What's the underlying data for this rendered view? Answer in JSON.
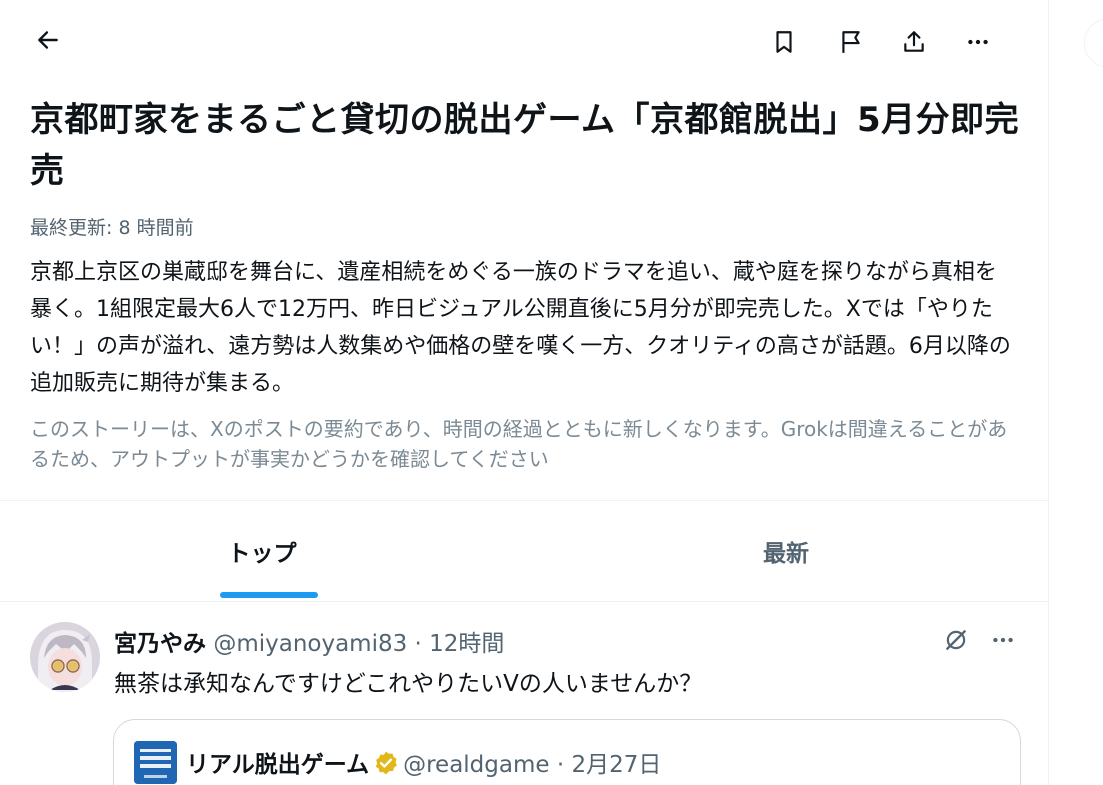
{
  "story": {
    "title": "京都町家をまるごと貸切の脱出ゲーム「京都館脱出」5月分即完売",
    "updated": "最終更新: 8 時間前",
    "summary": "京都上京区の巣蔵邸を舞台に、遺産相続をめぐる一族のドラマを追い、蔵や庭を探りながら真相を暴く。1組限定最大6人で12万円、昨日ビジュアル公開直後に5月分が即完売した。Xでは「やりたい！」の声が溢れ、遠方勢は人数集めや価格の壁を嘆く一方、クオリティの高さが話題。6月以降の追加販売に期待が集まる。",
    "disclaimer": "このストーリーは、Xのポストの要約であり、時間の経過とともに新しくなります。Grokは間違えることがあるため、アウトプットが事実かどうかを確認してください"
  },
  "tabs": [
    {
      "label": "トップ",
      "active": true
    },
    {
      "label": "最新",
      "active": false
    }
  ],
  "post": {
    "display_name": "宮乃やみ",
    "meta": "@miyanoyami83 · 12時間",
    "text": "無茶は承知なんですけどこれやりたいVの人いませんか？",
    "quote": {
      "display_name": "リアル脱出ゲーム",
      "meta": "@realdgame · 2月27日"
    }
  },
  "icons": [
    "back-arrow-icon",
    "bookmark-icon",
    "flag-icon",
    "share-icon",
    "more-icon",
    "grok-icon",
    "verified-badge-icon"
  ],
  "colors": {
    "accent": "#1d9bf0",
    "text": "#0f1419",
    "secondary": "#536471",
    "verified": "#e2b719"
  }
}
